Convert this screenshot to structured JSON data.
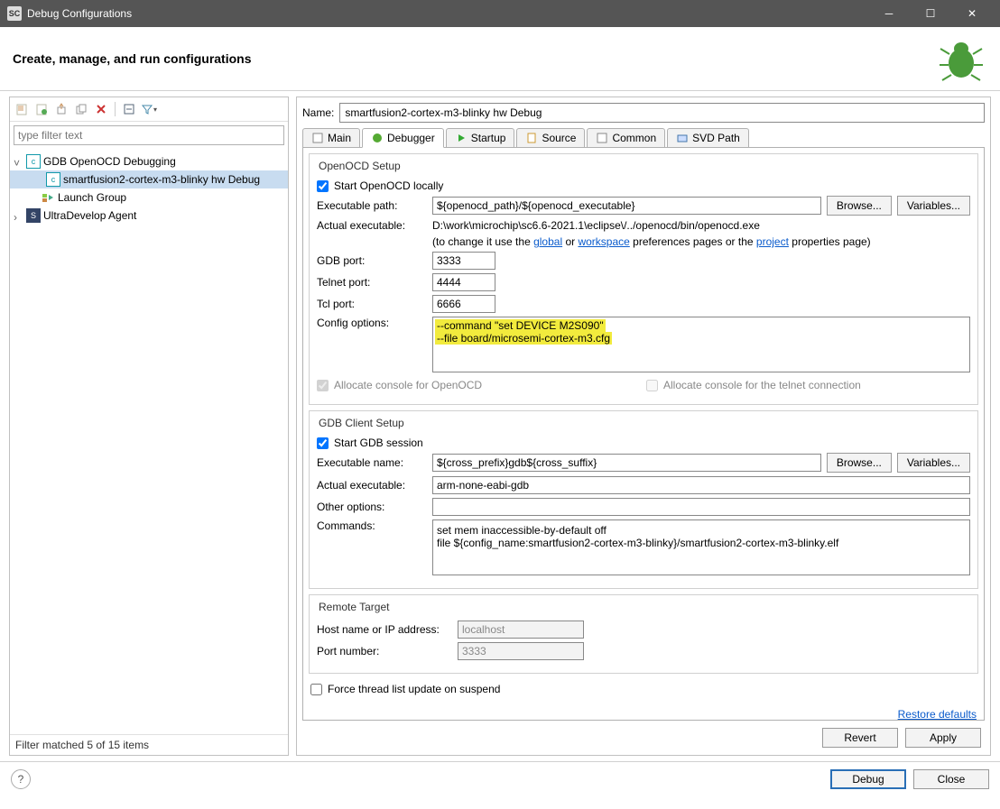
{
  "window": {
    "title": "Debug Configurations"
  },
  "banner": {
    "heading": "Create, manage, and run configurations"
  },
  "toolbar_icons": [
    "new",
    "dup",
    "export",
    "import",
    "delete",
    "tree",
    "filter"
  ],
  "tree": {
    "filter_placeholder": "type filter text",
    "items": [
      {
        "label": "GDB OpenOCD Debugging",
        "expanded": true,
        "icon": "c"
      },
      {
        "label": "smartfusion2-cortex-m3-blinky hw Debug",
        "indent": 2,
        "selected": true,
        "icon": "c"
      },
      {
        "label": "Launch Group",
        "indent": 1,
        "icon": "lg"
      },
      {
        "label": "UltraDevelop Agent",
        "indent": 1,
        "expandable": true,
        "icon": "sc"
      }
    ],
    "status": "Filter matched 5 of 15 items"
  },
  "form": {
    "name_label": "Name:",
    "name_value": "smartfusion2-cortex-m3-blinky hw Debug",
    "tabs": [
      "Main",
      "Debugger",
      "Startup",
      "Source",
      "Common",
      "SVD Path"
    ],
    "active_tab": "Debugger"
  },
  "openocd": {
    "group": "OpenOCD Setup",
    "start_label": "Start OpenOCD locally",
    "start_checked": true,
    "exepath_label": "Executable path:",
    "exepath_value": "${openocd_path}/${openocd_executable}",
    "actual_label": "Actual executable:",
    "actual_value": "D:\\work\\microchip\\sc6.6-2021.1\\eclipse\\/../openocd/bin/openocd.exe",
    "hint_pre": "(to change it use the ",
    "hint_link1": "global",
    "hint_mid": " or ",
    "hint_link2": "workspace",
    "hint_mid2": " preferences pages or the ",
    "hint_link3": "project",
    "hint_post": " properties page)",
    "gdb_port_label": "GDB port:",
    "gdb_port": "3333",
    "telnet_port_label": "Telnet port:",
    "telnet_port": "4444",
    "tcl_port_label": "Tcl port:",
    "tcl_port": "6666",
    "config_label": "Config options:",
    "config_value": "--command \"set DEVICE M2S090\"\n--file board/microsemi-cortex-m3.cfg",
    "alloc_openocd": "Allocate console for OpenOCD",
    "alloc_telnet": "Allocate console for the telnet connection"
  },
  "gdb": {
    "group": "GDB Client Setup",
    "start_label": "Start GDB session",
    "start_checked": true,
    "exe_label": "Executable name:",
    "exe_value": "${cross_prefix}gdb${cross_suffix}",
    "actual_label": "Actual executable:",
    "actual_value": "arm-none-eabi-gdb",
    "other_label": "Other options:",
    "other_value": "",
    "commands_label": "Commands:",
    "commands_value": "set mem inaccessible-by-default off\nfile ${config_name:smartfusion2-cortex-m3-blinky}/smartfusion2-cortex-m3-blinky.elf"
  },
  "remote": {
    "group": "Remote Target",
    "host_label": "Host name or IP address:",
    "host_value": "localhost",
    "port_label": "Port number:",
    "port_value": "3333"
  },
  "force_label": "Force thread list update on suspend",
  "restore": "Restore defaults",
  "buttons": {
    "browse": "Browse...",
    "variables": "Variables...",
    "revert": "Revert",
    "apply": "Apply",
    "debug": "Debug",
    "close": "Close"
  }
}
